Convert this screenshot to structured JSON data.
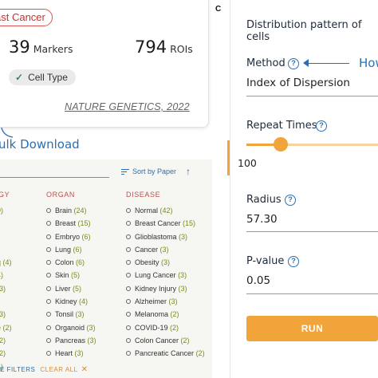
{
  "paper_card": {
    "tag": "ast Cancer",
    "markers_count": "39",
    "markers_label": "Markers",
    "rois_count": "794",
    "rois_label": "ROIs",
    "chip_label": "Cell Type",
    "journal": "NATURE GENETICS, 2022"
  },
  "bulk_download": "ulk Download",
  "filters": {
    "sort_label": "Sort by Paper",
    "headers": {
      "technology": "GY",
      "organ": "ORGAN",
      "disease": "DISEASE"
    },
    "technology_rows": [
      "9)",
      "",
      "",
      "",
      "q  (4)",
      "4)",
      "(3)",
      "",
      "(3)",
      "e  (2)",
      "(2)",
      "(2)",
      "1)"
    ],
    "organ_rows": [
      {
        "name": "Brain",
        "count": "(24)"
      },
      {
        "name": "Breast",
        "count": "(15)"
      },
      {
        "name": "Embryo",
        "count": "(6)"
      },
      {
        "name": "Lung",
        "count": "(6)"
      },
      {
        "name": "Colon",
        "count": "(6)"
      },
      {
        "name": "Skin",
        "count": "(5)"
      },
      {
        "name": "Liver",
        "count": "(5)"
      },
      {
        "name": "Kidney",
        "count": "(4)"
      },
      {
        "name": "Tonsil",
        "count": "(3)"
      },
      {
        "name": "Organoid",
        "count": "(3)"
      },
      {
        "name": "Pancreas",
        "count": "(3)"
      },
      {
        "name": "Heart",
        "count": "(3)"
      }
    ],
    "disease_rows": [
      {
        "name": "Normal",
        "count": "(42)"
      },
      {
        "name": "Breast Cancer",
        "count": "(15)"
      },
      {
        "name": "Glioblastoma",
        "count": "(3)"
      },
      {
        "name": "Cancer",
        "count": "(3)"
      },
      {
        "name": "Obesity",
        "count": "(3)"
      },
      {
        "name": "Lung Cancer",
        "count": "(3)"
      },
      {
        "name": "Kidney Injury",
        "count": "(3)"
      },
      {
        "name": "Alzheimer",
        "count": "(3)"
      },
      {
        "name": "Melanoma",
        "count": "(2)"
      },
      {
        "name": "COVID-19",
        "count": "(2)"
      },
      {
        "name": "Colon Cancer",
        "count": "(2)"
      },
      {
        "name": "Pancreatic Cancer",
        "count": "(2)"
      }
    ],
    "selected_filters": "E FILTERS",
    "clear_all": "CLEAR ALL"
  },
  "form": {
    "panel_label": "C",
    "distribution_title": "Distribution pattern of cells",
    "method_label": "Method",
    "method_value": "Index of Dispersion",
    "how_text": "How",
    "repeat_label": "Repeat Times",
    "repeat_value": "100",
    "repeat_slider_fraction": 0.26,
    "radius_label": "Radius",
    "radius_value": "57.30",
    "pvalue_label": "P-value",
    "pvalue_value": "0.05",
    "run_label": "RUN"
  },
  "colors": {
    "accent_orange": "#f0a43a",
    "link_blue": "#2a6fb5",
    "tag_red": "#c9302c",
    "count_olive": "#7a8a1a"
  }
}
